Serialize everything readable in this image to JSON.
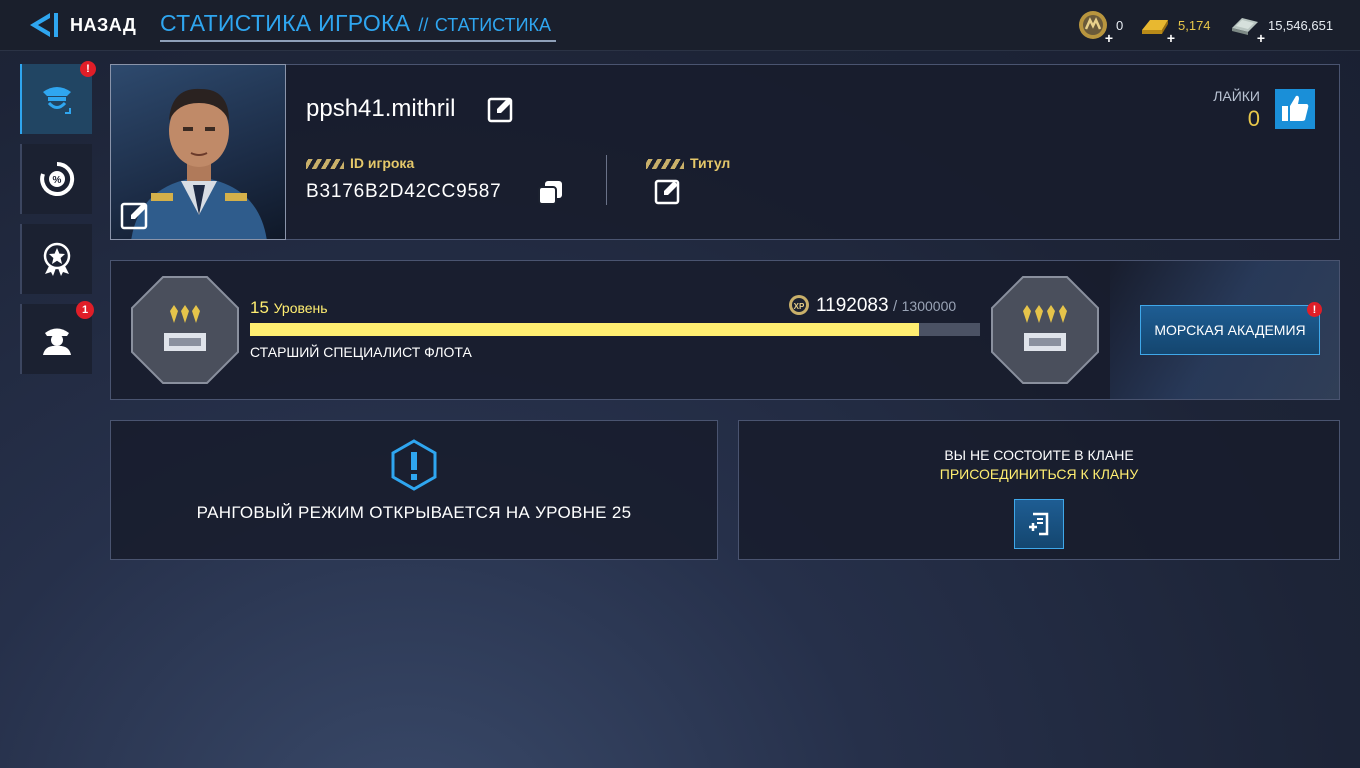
{
  "header": {
    "back_label": "НАЗАД",
    "title": "СТАТИСТИКА ИГРОКА",
    "separator": "//",
    "subtitle": "СТАТИСТИКА"
  },
  "currencies": [
    {
      "icon": "medal-coin-icon",
      "value": "0",
      "color": "#e8edf3"
    },
    {
      "icon": "gold-bar-icon",
      "value": "5,174",
      "color": "#e8c84a"
    },
    {
      "icon": "cash-stack-icon",
      "value": "15,546,651",
      "color": "#e8edf3"
    }
  ],
  "sidebar": {
    "items": [
      {
        "name": "profile",
        "icon": "officer-cap-icon",
        "active": true,
        "badge": "!"
      },
      {
        "name": "stats",
        "icon": "percent-gauge-icon",
        "active": false,
        "badge": ""
      },
      {
        "name": "achievements",
        "icon": "star-medal-icon",
        "active": false,
        "badge": ""
      },
      {
        "name": "crew",
        "icon": "crew-portrait-icon",
        "active": false,
        "badge": "1"
      }
    ]
  },
  "profile": {
    "username": "ppsh41.mithril",
    "id_label": "ID игрока",
    "player_id": "B3176B2D42CC9587",
    "title_label": "Титул",
    "likes_label": "ЛАЙКИ",
    "likes_count": "0"
  },
  "level": {
    "number": "15",
    "label": "Уровень",
    "xp_current": "1192083",
    "xp_separator": "/",
    "xp_max": "1300000",
    "progress_fraction": 0.917,
    "rank_name": "СТАРШИЙ СПЕЦИАЛИСТ ФЛОТА",
    "academy_button": "МОРСКАЯ АКАДЕМИЯ",
    "academy_badge": "!"
  },
  "ranked": {
    "message": "РАНГОВЫЙ РЕЖИМ ОТКРЫВАЕТСЯ НА УРОВНЕ 25"
  },
  "clan": {
    "status": "ВЫ НЕ СОСТОИТЕ В КЛАНЕ",
    "join_label": "ПРИСОЕДИНИТЬСЯ К КЛАНУ"
  },
  "colors": {
    "accent_blue": "#2fa6f0",
    "gold": "#e5c86a",
    "progress": "#ffee71",
    "badge_red": "#e01e28"
  }
}
